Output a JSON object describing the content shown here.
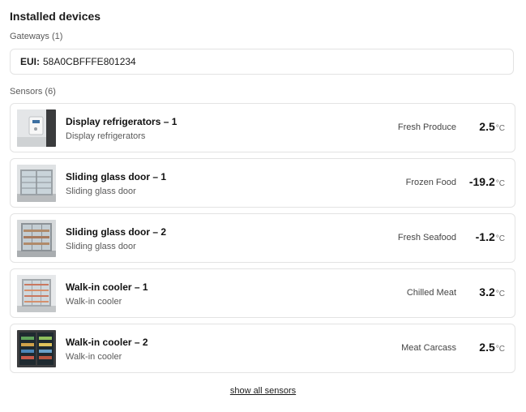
{
  "page": {
    "title": "Installed devices"
  },
  "gateways": {
    "label": "Gateways (1)",
    "items": [
      {
        "eui_key": "EUI:",
        "eui_value": "58A0CBFFFE801234"
      }
    ]
  },
  "sensors": {
    "label": "Sensors (6)",
    "items": [
      {
        "name": "Display refrigerators – 1",
        "type": "Display refrigerators",
        "category": "Fresh Produce",
        "temperature": "2.5",
        "unit": "°C",
        "thumb": "wall-sensor"
      },
      {
        "name": "Sliding glass door – 1",
        "type": "Sliding glass door",
        "category": "Frozen Food",
        "temperature": "-19.2",
        "unit": "°C",
        "thumb": "glass-door-fridge"
      },
      {
        "name": "Sliding glass door – 2",
        "type": "Sliding glass door",
        "category": "Fresh Seafood",
        "temperature": "-1.2",
        "unit": "°C",
        "thumb": "glass-door-fridge"
      },
      {
        "name": "Walk-in cooler – 1",
        "type": "Walk-in cooler",
        "category": "Chilled Meat",
        "temperature": "3.2",
        "unit": "°C",
        "thumb": "glass-door-fridge"
      },
      {
        "name": "Walk-in cooler – 2",
        "type": "Walk-in cooler",
        "category": "Meat Carcass",
        "temperature": "2.5",
        "unit": "°C",
        "thumb": "stocked-cooler"
      }
    ],
    "show_all_label": "show all sensors"
  }
}
